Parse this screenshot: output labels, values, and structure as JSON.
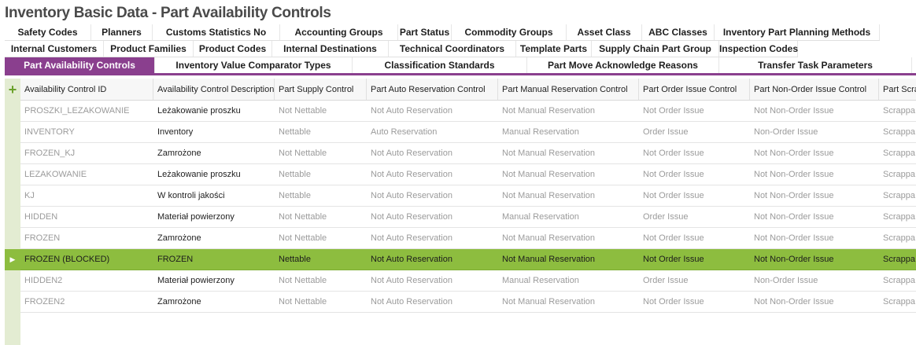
{
  "title": "Inventory Basic Data - Part Availability Controls",
  "tabs_row1": [
    "Safety Codes",
    "Planners",
    "Customs Statistics No",
    "Accounting Groups",
    "Part Status",
    "Commodity Groups",
    "Asset Class",
    "ABC Classes",
    "Inventory Part Planning Methods"
  ],
  "tabs_row2": [
    "Internal Customers",
    "Product Families",
    "Product Codes",
    "Internal Destinations",
    "Technical Coordinators",
    "Template Parts",
    "Supply Chain Part Group",
    "Inspection Codes"
  ],
  "tabs_row3": [
    "Part Availability Controls",
    "Inventory Value Comparator Types",
    "Classification Standards",
    "Part Move Acknowledge Reasons",
    "Transfer Task Parameters"
  ],
  "active_tab": "Part Availability Controls",
  "colors": {
    "accent": "#8a3f8e",
    "selected_row": "#8dbd3f",
    "side_bar": "#e3ecd2",
    "add_icon": "#6aa12a"
  },
  "add_icon": "plus-icon",
  "columns": [
    "Availability Control ID",
    "Availability Control Description",
    "Part Supply Control",
    "Part Auto Reservation Control",
    "Part Manual Reservation Control",
    "Part Order Issue Control",
    "Part Non-Order Issue Control",
    "Part Scra"
  ],
  "rows": [
    [
      "PROSZKI_LEZAKOWANIE",
      "Leżakowanie proszku",
      "Not Nettable",
      "Not Auto Reservation",
      "Not Manual Reservation",
      "Not Order Issue",
      "Not Non-Order Issue",
      "Scrappa"
    ],
    [
      "INVENTORY",
      "Inventory",
      "Nettable",
      "Auto Reservation",
      "Manual Reservation",
      "Order Issue",
      "Non-Order Issue",
      "Scrappa"
    ],
    [
      "FROZEN_KJ",
      "Zamrożone",
      "Not Nettable",
      "Not Auto Reservation",
      "Not Manual Reservation",
      "Not Order Issue",
      "Not Non-Order Issue",
      "Scrappa"
    ],
    [
      "LEZAKOWANIE",
      "Leżakowanie proszku",
      "Nettable",
      "Not Auto Reservation",
      "Not Manual Reservation",
      "Not Order Issue",
      "Not Non-Order Issue",
      "Scrappa"
    ],
    [
      "KJ",
      "W kontroli jakości",
      "Nettable",
      "Not Auto Reservation",
      "Not Manual Reservation",
      "Not Order Issue",
      "Not Non-Order Issue",
      "Scrappa"
    ],
    [
      "HIDDEN",
      "Materiał powierzony",
      "Not Nettable",
      "Not Auto Reservation",
      "Manual Reservation",
      "Order Issue",
      "Not Non-Order Issue",
      "Scrappa"
    ],
    [
      "FROZEN",
      "Zamrożone",
      "Not Nettable",
      "Not Auto Reservation",
      "Not Manual Reservation",
      "Not Order Issue",
      "Not Non-Order Issue",
      "Scrappa"
    ],
    [
      "FROZEN (BLOCKED)",
      "FROZEN",
      "Nettable",
      "Not Auto Reservation",
      "Not Manual Reservation",
      "Not Order Issue",
      "Not Non-Order Issue",
      "Scrappa"
    ],
    [
      "HIDDEN2",
      "Materiał powierzony",
      "Not Nettable",
      "Not Auto Reservation",
      "Manual Reservation",
      "Order Issue",
      "Non-Order Issue",
      "Scrappa"
    ],
    [
      "FROZEN2",
      "Zamrożone",
      "Not Nettable",
      "Not Auto Reservation",
      "Not Manual Reservation",
      "Not Order Issue",
      "Not Non-Order Issue",
      "Scrappa"
    ]
  ],
  "selected_row_index": 7
}
